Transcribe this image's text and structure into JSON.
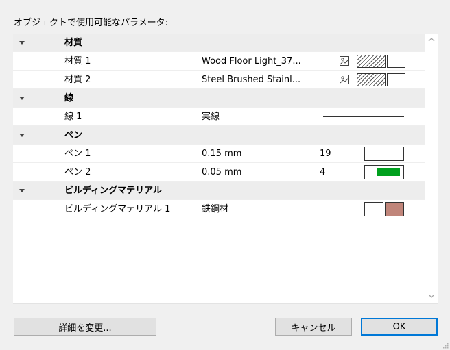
{
  "dialog": {
    "title": "オブジェクトで使用可能なパラメータ:"
  },
  "groups": {
    "material": {
      "label": "材質",
      "items": [
        {
          "label": "材質 1",
          "value": "Wood Floor Light_37..."
        },
        {
          "label": "材質 2",
          "value": "Steel Brushed Stainl..."
        }
      ]
    },
    "line": {
      "label": "線",
      "items": [
        {
          "label": "線 1",
          "value": "実線"
        }
      ]
    },
    "pen": {
      "label": "ペン",
      "items": [
        {
          "label": "ペン 1",
          "value": "0.15 mm",
          "number": "19",
          "color": "#ffffff"
        },
        {
          "label": "ペン 2",
          "value": "0.05 mm",
          "number": "4",
          "color": "#00a01e"
        }
      ]
    },
    "building_material": {
      "label": "ビルディングマテリアル",
      "items": [
        {
          "label": "ビルディングマテリアル 1",
          "value": "鉄鋼材",
          "color": "#c0857a"
        }
      ]
    }
  },
  "buttons": {
    "change_details": "詳細を変更...",
    "cancel": "キャンセル",
    "ok": "OK"
  },
  "colors": {
    "accent": "#0078d7",
    "group_bg": "#ededed",
    "pen2_green": "#00a01e",
    "building_swatch": "#c0857a"
  }
}
